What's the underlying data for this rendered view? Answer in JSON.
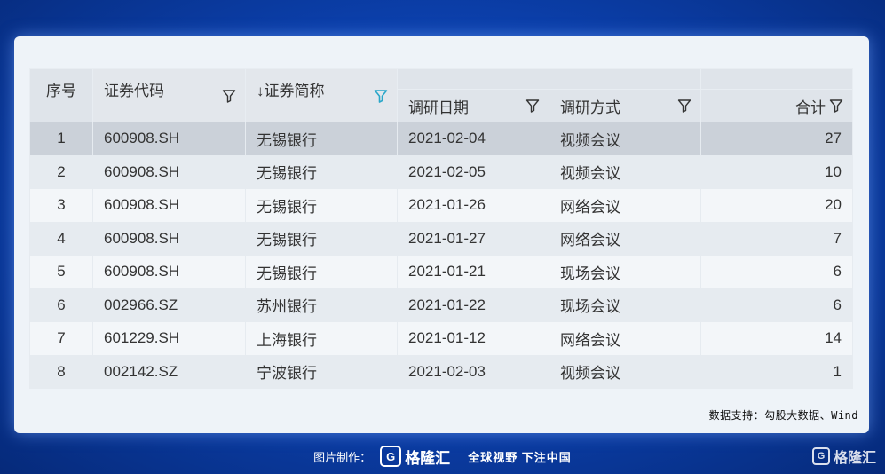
{
  "table": {
    "columns": {
      "idx": "序号",
      "code": "证券代码",
      "name": "↓证券简称",
      "date": "调研日期",
      "method": "调研方式",
      "total": "合计"
    },
    "rows": [
      {
        "idx": "1",
        "code": "600908.SH",
        "name": "无锡银行",
        "date": "2021-02-04",
        "method": "视频会议",
        "total": "27"
      },
      {
        "idx": "2",
        "code": "600908.SH",
        "name": "无锡银行",
        "date": "2021-02-05",
        "method": "视频会议",
        "total": "10"
      },
      {
        "idx": "3",
        "code": "600908.SH",
        "name": "无锡银行",
        "date": "2021-01-26",
        "method": "网络会议",
        "total": "20"
      },
      {
        "idx": "4",
        "code": "600908.SH",
        "name": "无锡银行",
        "date": "2021-01-27",
        "method": "网络会议",
        "total": "7"
      },
      {
        "idx": "5",
        "code": "600908.SH",
        "name": "无锡银行",
        "date": "2021-01-21",
        "method": "现场会议",
        "total": "6"
      },
      {
        "idx": "6",
        "code": "002966.SZ",
        "name": "苏州银行",
        "date": "2021-01-22",
        "method": "现场会议",
        "total": "6"
      },
      {
        "idx": "7",
        "code": "601229.SH",
        "name": "上海银行",
        "date": "2021-01-12",
        "method": "网络会议",
        "total": "14"
      },
      {
        "idx": "8",
        "code": "002142.SZ",
        "name": "宁波银行",
        "date": "2021-02-03",
        "method": "视频会议",
        "total": "1"
      }
    ]
  },
  "source": "数据支持：勾股大数据、Wind",
  "watermark": {
    "logo": "G",
    "brand": "格隆汇",
    "brand2": "勾股大数据"
  },
  "footer": {
    "label": "图片制作：",
    "logo": "G",
    "logo_text": "格隆汇",
    "slogan": "全球视野 下注中国"
  },
  "corner": {
    "logo": "G",
    "text": "格隆汇"
  },
  "colors": {
    "filter_icon": "#333333",
    "filter_icon_active": "#2aa7c9",
    "selected_row": "#cbd1d9"
  }
}
